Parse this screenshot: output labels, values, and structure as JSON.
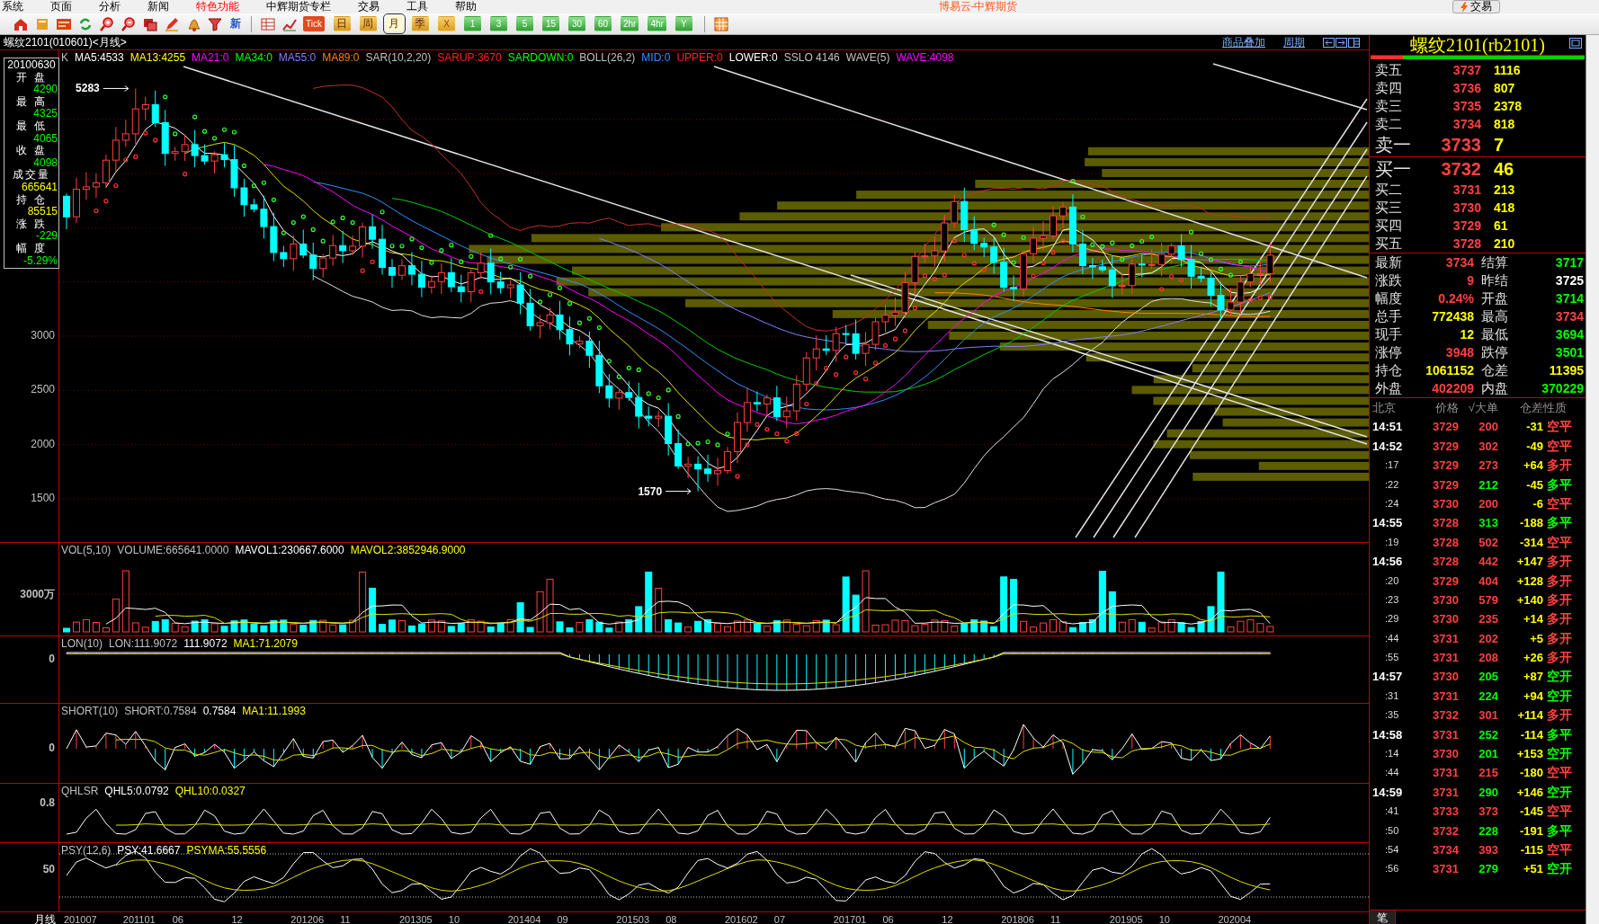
{
  "window": {
    "title": "博易云-中辉期货"
  },
  "menu": [
    {
      "label": "系统",
      "highlighted": false
    },
    {
      "label": "页面",
      "highlighted": false
    },
    {
      "label": "分析",
      "highlighted": false
    },
    {
      "label": "新闻",
      "highlighted": false
    },
    {
      "label": "特色功能",
      "highlighted": true
    },
    {
      "label": "中辉期货专栏",
      "highlighted": false
    },
    {
      "label": "交易",
      "highlighted": false
    },
    {
      "label": "工具",
      "highlighted": false
    },
    {
      "label": "帮助",
      "highlighted": false
    }
  ],
  "trade_button": "交易",
  "toolbar": {
    "news_button": "新",
    "periods": [
      {
        "label": "Tick",
        "kind": "tick",
        "selected": false
      },
      {
        "label": "日",
        "kind": "calendar",
        "selected": false
      },
      {
        "label": "周",
        "kind": "calendar",
        "selected": false
      },
      {
        "label": "月",
        "kind": "calendar",
        "selected": true
      },
      {
        "label": "季",
        "kind": "calendar",
        "selected": false
      },
      {
        "label": "X",
        "kind": "custom",
        "selected": false
      },
      {
        "label": "1",
        "kind": "minute",
        "selected": false
      },
      {
        "label": "3",
        "kind": "minute",
        "selected": false
      },
      {
        "label": "5",
        "kind": "minute",
        "selected": false
      },
      {
        "label": "15",
        "kind": "minute",
        "selected": false
      },
      {
        "label": "30",
        "kind": "minute",
        "selected": false
      },
      {
        "label": "60",
        "kind": "minute",
        "selected": false
      },
      {
        "label": "2hr",
        "kind": "minute",
        "selected": false
      },
      {
        "label": "4hr",
        "kind": "minute",
        "selected": false
      },
      {
        "label": "Y",
        "kind": "minute",
        "selected": false
      }
    ]
  },
  "chart_header": {
    "title": "螺纹2101(010601)<月线>",
    "links": [
      "商品叠加",
      "周期"
    ]
  },
  "main_chart": {
    "legend": [
      {
        "text": "K",
        "color": "#c0c0c0"
      },
      {
        "text": "MA5:4533",
        "color": "#ffffff"
      },
      {
        "text": "MA13:4255",
        "color": "#ffff00"
      },
      {
        "text": "MA21:0",
        "color": "#ff00ff"
      },
      {
        "text": "MA34:0",
        "color": "#00ff00"
      },
      {
        "text": "MA55:0",
        "color": "#8080ff"
      },
      {
        "text": "MA89:0",
        "color": "#ff8000"
      },
      {
        "text": "SAR(10,2,20)",
        "color": "#c0c0c0"
      },
      {
        "text": "SARUP:3670",
        "color": "#ff2020"
      },
      {
        "text": "SARDOWN:0",
        "color": "#00ff00"
      },
      {
        "text": "BOLL(26,2)",
        "color": "#c0c0c0"
      },
      {
        "text": "MID:0",
        "color": "#3090ff"
      },
      {
        "text": "UPPER:0",
        "color": "#ff2020"
      },
      {
        "text": "LOWER:0",
        "color": "#ffffff"
      },
      {
        "text": "SSLO 4146",
        "color": "#c0c0c0"
      },
      {
        "text": "WAVE(5)",
        "color": "#c0c0c0"
      },
      {
        "text": "WAVE:4098",
        "color": "#ff00ff"
      }
    ],
    "price_labels": [
      "3000",
      "2500",
      "2000",
      "1500"
    ],
    "annotations": [
      {
        "kind": "high",
        "text": "5283"
      },
      {
        "kind": "low",
        "text": "1570"
      }
    ],
    "info_box": {
      "date": "20100630",
      "fields": [
        {
          "label": "开 盘",
          "value": "4290",
          "color": "#00ff00"
        },
        {
          "label": "最 高",
          "value": "4325",
          "color": "#00ff00"
        },
        {
          "label": "最 低",
          "value": "4065",
          "color": "#00ff00"
        },
        {
          "label": "收 盘",
          "value": "4098",
          "color": "#00ff00"
        },
        {
          "label": "成交量",
          "value": "665641",
          "color": "#ffff00"
        },
        {
          "label": "持 仓",
          "value": "85515",
          "color": "#ffff00"
        },
        {
          "label": "涨 跌",
          "value": "-229",
          "color": "#00ff00"
        },
        {
          "label": "幅 度",
          "value": "-5.29%",
          "color": "#00ff00"
        }
      ]
    }
  },
  "sub_panels": [
    {
      "kind": "volume",
      "axis_label": "3000万",
      "legend": [
        {
          "text": "VOL(5,10)",
          "color": "#c0c0c0"
        },
        {
          "text": "VOLUME:665641.0000",
          "color": "#c0c0c0"
        },
        {
          "text": "MAVOL1:230667.6000",
          "color": "#ffffff"
        },
        {
          "text": "MAVOL2:3852946.9000",
          "color": "#ffff00"
        }
      ]
    },
    {
      "kind": "lon",
      "axis_label": "0",
      "legend": [
        {
          "text": "LON(10)",
          "color": "#c0c0c0"
        },
        {
          "text": "LON:111.9072",
          "color": "#c0c0c0"
        },
        {
          "text": "111.9072",
          "color": "#ffffff"
        },
        {
          "text": "MA1:71.2079",
          "color": "#ffff00"
        }
      ]
    },
    {
      "kind": "short",
      "axis_label": "0",
      "legend": [
        {
          "text": "SHORT(10)",
          "color": "#c0c0c0"
        },
        {
          "text": "SHORT:0.7584",
          "color": "#c0c0c0"
        },
        {
          "text": "0.7584",
          "color": "#ffffff"
        },
        {
          "text": "MA1:11.1993",
          "color": "#ffff00"
        }
      ]
    },
    {
      "kind": "qhlsr",
      "axis_label": "0.8",
      "legend": [
        {
          "text": "QHLSR",
          "color": "#c0c0c0"
        },
        {
          "text": "QHL5:0.0792",
          "color": "#ffffff"
        },
        {
          "text": "QHL10:0.0327",
          "color": "#ffff00"
        }
      ]
    },
    {
      "kind": "psy",
      "axis_label": "50",
      "legend": [
        {
          "text": "PSY(12,6)",
          "color": "#c0c0c0"
        },
        {
          "text": "PSY:41.6667",
          "color": "#ffffff"
        },
        {
          "text": "PSYMA:55.5556",
          "color": "#ffff00"
        }
      ]
    }
  ],
  "date_axis": {
    "period": "月线",
    "dates": [
      "201007",
      "201101",
      "06",
      "12",
      "201206",
      "11",
      "201305",
      "10",
      "201404",
      "09",
      "201503",
      "08",
      "201602",
      "07",
      "201701",
      "06",
      "12",
      "201806",
      "11",
      "201905",
      "10",
      "202004"
    ]
  },
  "quote": {
    "title": "螺纹2101(rb2101)",
    "ratio": {
      "level": 0.15
    },
    "asks": [
      {
        "label": "卖五",
        "price": "3737",
        "volume": "1116",
        "kind": "level"
      },
      {
        "label": "卖四",
        "price": "3736",
        "volume": "807",
        "kind": "level"
      },
      {
        "label": "卖三",
        "price": "3735",
        "volume": "2378",
        "kind": "level"
      },
      {
        "label": "卖二",
        "price": "3734",
        "volume": "818",
        "kind": "level"
      },
      {
        "label": "卖一",
        "price": "3733",
        "volume": "7",
        "kind": "best"
      }
    ],
    "bids": [
      {
        "label": "买一",
        "price": "3732",
        "volume": "46",
        "kind": "best"
      },
      {
        "label": "买二",
        "price": "3731",
        "volume": "213",
        "kind": "level"
      },
      {
        "label": "买三",
        "price": "3730",
        "volume": "418",
        "kind": "level"
      },
      {
        "label": "买四",
        "price": "3729",
        "volume": "61",
        "kind": "level"
      },
      {
        "label": "买五",
        "price": "3728",
        "volume": "210",
        "kind": "level"
      }
    ],
    "stats": [
      {
        "label": "最新",
        "value": "3734",
        "color": "#ff4040"
      },
      {
        "label": "结算",
        "value": "3717",
        "color": "#00ff00"
      },
      {
        "label": "涨跌",
        "value": "9",
        "color": "#ff4040"
      },
      {
        "label": "昨结",
        "value": "3725",
        "color": "#ffffff"
      },
      {
        "label": "幅度",
        "value": "0.24%",
        "color": "#ff4040"
      },
      {
        "label": "开盘",
        "value": "3714",
        "color": "#00ff00"
      },
      {
        "label": "总手",
        "value": "772438",
        "color": "#ffff00"
      },
      {
        "label": "最高",
        "value": "3734",
        "color": "#ff4040"
      },
      {
        "label": "现手",
        "value": "12",
        "color": "#ffff00"
      },
      {
        "label": "最低",
        "value": "3694",
        "color": "#00ff00"
      },
      {
        "label": "涨停",
        "value": "3948",
        "color": "#ff4040"
      },
      {
        "label": "跌停",
        "value": "3501",
        "color": "#00ff00"
      },
      {
        "label": "持仓",
        "value": "1061152",
        "color": "#ffff00"
      },
      {
        "label": "仓差",
        "value": "11395",
        "color": "#ffff00"
      },
      {
        "label": "外盘",
        "value": "402209",
        "color": "#ff4040"
      },
      {
        "label": "内盘",
        "value": "370229",
        "color": "#00ff00"
      }
    ]
  },
  "ticks": {
    "columns": [
      "北京",
      "价格",
      "√大单",
      "仓差",
      "性质"
    ],
    "rows": [
      {
        "time": "14:51",
        "kind": "minute",
        "price": "3729",
        "size": {
          "text": "200",
          "color": "#ff4040"
        },
        "oi_change": "-31",
        "nature": {
          "text": "空平",
          "color": "#ff4040"
        }
      },
      {
        "time": "14:52",
        "kind": "minute",
        "price": "3729",
        "size": {
          "text": "302",
          "color": "#ff4040"
        },
        "oi_change": "-49",
        "nature": {
          "text": "空平",
          "color": "#ff4040"
        }
      },
      {
        "time": ":17",
        "kind": "second",
        "price": "3729",
        "size": {
          "text": "273",
          "color": "#ff4040"
        },
        "oi_change": "+64",
        "nature": {
          "text": "多开",
          "color": "#ff4040"
        }
      },
      {
        "time": ":22",
        "kind": "second",
        "price": "3729",
        "size": {
          "text": "212",
          "color": "#00ff00"
        },
        "oi_change": "-45",
        "nature": {
          "text": "多平",
          "color": "#00ff00"
        }
      },
      {
        "time": ":24",
        "kind": "second",
        "price": "3730",
        "size": {
          "text": "200",
          "color": "#ff4040"
        },
        "oi_change": "-6",
        "nature": {
          "text": "空平",
          "color": "#ff4040"
        }
      },
      {
        "time": "14:55",
        "kind": "minute",
        "price": "3728",
        "size": {
          "text": "313",
          "color": "#00ff00"
        },
        "oi_change": "-188",
        "nature": {
          "text": "多平",
          "color": "#00ff00"
        }
      },
      {
        "time": ":19",
        "kind": "second",
        "price": "3728",
        "size": {
          "text": "502",
          "color": "#ff4040"
        },
        "oi_change": "-314",
        "nature": {
          "text": "空平",
          "color": "#ff4040"
        }
      },
      {
        "time": "14:56",
        "kind": "minute",
        "price": "3728",
        "size": {
          "text": "442",
          "color": "#ff4040"
        },
        "oi_change": "+147",
        "nature": {
          "text": "多开",
          "color": "#ff4040"
        }
      },
      {
        "time": ":20",
        "kind": "second",
        "price": "3729",
        "size": {
          "text": "404",
          "color": "#ff4040"
        },
        "oi_change": "+128",
        "nature": {
          "text": "多开",
          "color": "#ff4040"
        }
      },
      {
        "time": ":23",
        "kind": "second",
        "price": "3730",
        "size": {
          "text": "579",
          "color": "#ff4040"
        },
        "oi_change": "+140",
        "nature": {
          "text": "多开",
          "color": "#ff4040"
        }
      },
      {
        "time": ":29",
        "kind": "second",
        "price": "3730",
        "size": {
          "text": "235",
          "color": "#ff4040"
        },
        "oi_change": "+14",
        "nature": {
          "text": "多开",
          "color": "#ff4040"
        }
      },
      {
        "time": ":44",
        "kind": "second",
        "price": "3731",
        "size": {
          "text": "202",
          "color": "#ff4040"
        },
        "oi_change": "+5",
        "nature": {
          "text": "多开",
          "color": "#ff4040"
        }
      },
      {
        "time": ":55",
        "kind": "second",
        "price": "3731",
        "size": {
          "text": "208",
          "color": "#ff4040"
        },
        "oi_change": "+26",
        "nature": {
          "text": "多开",
          "color": "#ff4040"
        }
      },
      {
        "time": "14:57",
        "kind": "minute",
        "price": "3730",
        "size": {
          "text": "205",
          "color": "#00ff00"
        },
        "oi_change": "+87",
        "nature": {
          "text": "空开",
          "color": "#00ff00"
        }
      },
      {
        "time": ":31",
        "kind": "second",
        "price": "3731",
        "size": {
          "text": "224",
          "color": "#00ff00"
        },
        "oi_change": "+94",
        "nature": {
          "text": "空开",
          "color": "#00ff00"
        }
      },
      {
        "time": ":35",
        "kind": "second",
        "price": "3732",
        "size": {
          "text": "301",
          "color": "#ff4040"
        },
        "oi_change": "+114",
        "nature": {
          "text": "多开",
          "color": "#ff4040"
        }
      },
      {
        "time": "14:58",
        "kind": "minute",
        "price": "3731",
        "size": {
          "text": "252",
          "color": "#00ff00"
        },
        "oi_change": "-114",
        "nature": {
          "text": "多平",
          "color": "#00ff00"
        }
      },
      {
        "time": ":14",
        "kind": "second",
        "price": "3730",
        "size": {
          "text": "201",
          "color": "#00ff00"
        },
        "oi_change": "+153",
        "nature": {
          "text": "空开",
          "color": "#00ff00"
        }
      },
      {
        "time": ":44",
        "kind": "second",
        "price": "3731",
        "size": {
          "text": "215",
          "color": "#ff4040"
        },
        "oi_change": "-180",
        "nature": {
          "text": "空平",
          "color": "#ff4040"
        }
      },
      {
        "time": "14:59",
        "kind": "minute",
        "price": "3731",
        "size": {
          "text": "290",
          "color": "#00ff00"
        },
        "oi_change": "+146",
        "nature": {
          "text": "空开",
          "color": "#00ff00"
        }
      },
      {
        "time": ":41",
        "kind": "second",
        "price": "3733",
        "size": {
          "text": "373",
          "color": "#ff4040"
        },
        "oi_change": "-145",
        "nature": {
          "text": "空平",
          "color": "#ff4040"
        }
      },
      {
        "time": ":50",
        "kind": "second",
        "price": "3732",
        "size": {
          "text": "228",
          "color": "#00ff00"
        },
        "oi_change": "-191",
        "nature": {
          "text": "多平",
          "color": "#00ff00"
        }
      },
      {
        "time": ":54",
        "kind": "second",
        "price": "3734",
        "size": {
          "text": "393",
          "color": "#ff4040"
        },
        "oi_change": "-115",
        "nature": {
          "text": "空平",
          "color": "#ff4040"
        }
      },
      {
        "time": ":56",
        "kind": "second",
        "price": "3731",
        "size": {
          "text": "279",
          "color": "#00ff00"
        },
        "oi_change": "+51",
        "nature": {
          "text": "空开",
          "color": "#00ff00"
        }
      }
    ],
    "tabs": [
      {
        "label": "笔",
        "selected": true
      }
    ]
  }
}
